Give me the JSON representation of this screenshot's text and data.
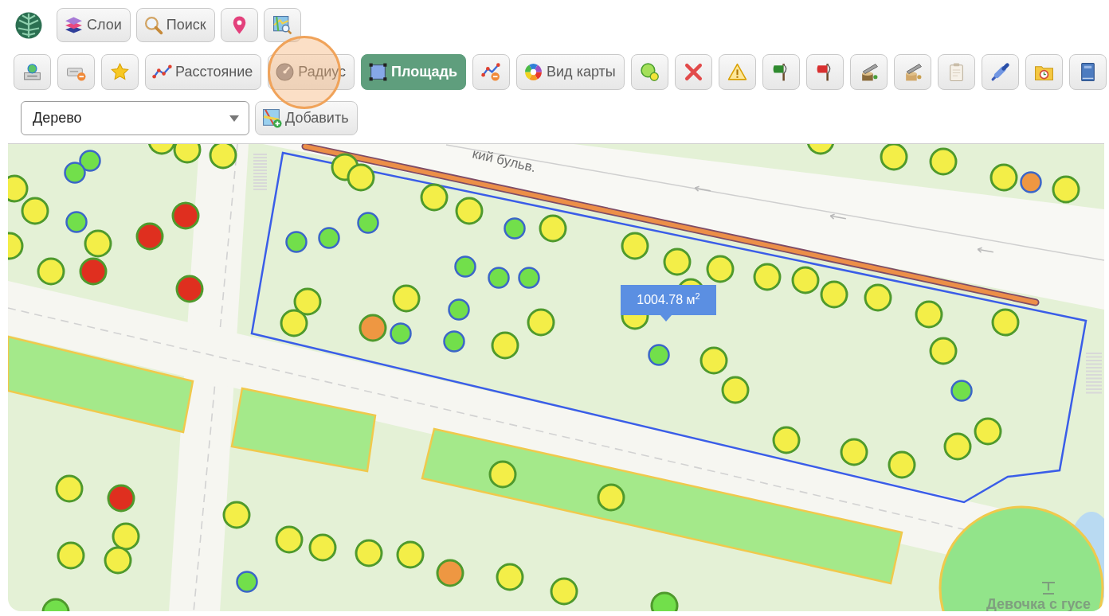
{
  "toolbar_top": [
    {
      "kind": "labeled",
      "label": "Слои"
    },
    {
      "kind": "labeled",
      "label": "Поиск"
    },
    {
      "kind": "icon"
    },
    {
      "kind": "icon"
    }
  ],
  "toolbar_tools": [
    {
      "kind": "icon",
      "selected": false,
      "highlighted": false
    },
    {
      "kind": "icon",
      "selected": false,
      "highlighted": false
    },
    {
      "kind": "icon",
      "selected": false,
      "highlighted": false
    },
    {
      "kind": "labeled",
      "label": "Расстояние",
      "selected": false,
      "highlighted": false
    },
    {
      "kind": "labeled",
      "label": "Радиус",
      "selected": false,
      "highlighted": true
    },
    {
      "kind": "labeled",
      "label": "Площадь",
      "selected": true,
      "highlighted": false
    },
    {
      "kind": "icon",
      "selected": false,
      "highlighted": false
    },
    {
      "kind": "labeled",
      "label": "Вид карты",
      "selected": false,
      "highlighted": false
    },
    {
      "kind": "icon",
      "selected": false,
      "highlighted": false
    },
    {
      "kind": "icon",
      "selected": false,
      "highlighted": false
    },
    {
      "kind": "icon",
      "selected": false,
      "highlighted": false
    },
    {
      "kind": "icon",
      "selected": false,
      "highlighted": false
    },
    {
      "kind": "icon",
      "selected": false,
      "highlighted": false
    },
    {
      "kind": "icon",
      "selected": false,
      "highlighted": false
    },
    {
      "kind": "icon",
      "selected": false,
      "highlighted": false
    },
    {
      "kind": "icon",
      "selected": false,
      "highlighted": false
    },
    {
      "kind": "icon",
      "selected": false,
      "highlighted": false
    },
    {
      "kind": "icon",
      "selected": false,
      "highlighted": false
    },
    {
      "kind": "icon",
      "selected": false,
      "highlighted": false
    }
  ],
  "feature_select": {
    "value": "Дерево"
  },
  "add_button": {
    "label": "Добавить"
  },
  "map": {
    "street_label": "кий бульв.",
    "trees": [
      {
        "kind": "large",
        "color": "#f3ee48"
      },
      {
        "kind": "large",
        "color": "#f3ee48"
      },
      {
        "kind": "large",
        "color": "#f3ee48"
      },
      {
        "kind": "large",
        "color": "#f3ee48"
      },
      {
        "kind": "large",
        "color": "#f3ee48"
      },
      {
        "kind": "small",
        "color": "#72df4b"
      },
      {
        "kind": "large",
        "color": "#f3ee48"
      },
      {
        "kind": "large",
        "color": "#f3ee48"
      },
      {
        "kind": "small",
        "color": "#72df4b"
      },
      {
        "kind": "large",
        "color": "#f3ee48"
      },
      {
        "kind": "large",
        "color": "#f3ee48"
      },
      {
        "kind": "small",
        "color": "#ee9742"
      },
      {
        "kind": "large",
        "color": "#f3ee48"
      },
      {
        "kind": "large",
        "color": "#f3ee48"
      },
      {
        "kind": "large",
        "color": "#f3ee48"
      },
      {
        "kind": "large",
        "color": "#f3ee48"
      },
      {
        "kind": "large",
        "color": "#f3ee48"
      },
      {
        "kind": "large",
        "color": "#df2f1f"
      },
      {
        "kind": "small",
        "color": "#72df4b"
      },
      {
        "kind": "small",
        "color": "#72df4b"
      },
      {
        "kind": "small",
        "color": "#72df4b"
      },
      {
        "kind": "large",
        "color": "#f3ee48"
      },
      {
        "kind": "large",
        "color": "#df2f1f"
      },
      {
        "kind": "small",
        "color": "#72df4b"
      },
      {
        "kind": "small",
        "color": "#72df4b"
      },
      {
        "kind": "large",
        "color": "#f3ee48"
      },
      {
        "kind": "large",
        "color": "#f3ee48"
      },
      {
        "kind": "large",
        "color": "#f3ee48"
      },
      {
        "kind": "large",
        "color": "#f3ee48"
      },
      {
        "kind": "small",
        "color": "#72df4b"
      },
      {
        "kind": "large",
        "color": "#f3ee48"
      },
      {
        "kind": "large",
        "color": "#f3ee48"
      },
      {
        "kind": "large",
        "color": "#df2f1f"
      },
      {
        "kind": "large",
        "color": "#f3ee48"
      },
      {
        "kind": "small",
        "color": "#72df4b"
      },
      {
        "kind": "small",
        "color": "#72df4b"
      },
      {
        "kind": "large",
        "color": "#f3ee48"
      },
      {
        "kind": "large",
        "color": "#df2f1f"
      },
      {
        "kind": "large",
        "color": "#f3ee48"
      },
      {
        "kind": "large",
        "color": "#f3ee48"
      },
      {
        "kind": "large",
        "color": "#f3ee48"
      },
      {
        "kind": "large",
        "color": "#f3ee48"
      },
      {
        "kind": "large",
        "color": "#f3ee48"
      },
      {
        "kind": "small",
        "color": "#72df4b"
      },
      {
        "kind": "large",
        "color": "#f3ee48"
      },
      {
        "kind": "large",
        "color": "#f3ee48"
      },
      {
        "kind": "large",
        "color": "#f3ee48"
      },
      {
        "kind": "large",
        "color": "#f3ee48"
      },
      {
        "kind": "large",
        "color": "#f3ee48"
      },
      {
        "kind": "large",
        "color": "#ee9742"
      },
      {
        "kind": "small",
        "color": "#72df4b"
      },
      {
        "kind": "small",
        "color": "#72df4b"
      },
      {
        "kind": "large",
        "color": "#f3ee48"
      },
      {
        "kind": "large",
        "color": "#f3ee48"
      },
      {
        "kind": "small",
        "color": "#72df4b"
      },
      {
        "kind": "large",
        "color": "#f3ee48"
      },
      {
        "kind": "large",
        "color": "#f3ee48"
      },
      {
        "kind": "small",
        "color": "#72df4b"
      },
      {
        "kind": "large",
        "color": "#f3ee48"
      },
      {
        "kind": "large",
        "color": "#f3ee48"
      },
      {
        "kind": "large",
        "color": "#f3ee48"
      },
      {
        "kind": "large",
        "color": "#f3ee48"
      },
      {
        "kind": "large",
        "color": "#f3ee48"
      },
      {
        "kind": "large",
        "color": "#f3ee48"
      },
      {
        "kind": "large",
        "color": "#f3ee48"
      },
      {
        "kind": "large",
        "color": "#f3ee48"
      },
      {
        "kind": "large",
        "color": "#df2f1f"
      },
      {
        "kind": "large",
        "color": "#f3ee48"
      },
      {
        "kind": "large",
        "color": "#f3ee48"
      },
      {
        "kind": "large",
        "color": "#f3ee48"
      },
      {
        "kind": "large",
        "color": "#f3ee48"
      },
      {
        "kind": "large",
        "color": "#f3ee48"
      },
      {
        "kind": "large",
        "color": "#f3ee48"
      },
      {
        "kind": "large",
        "color": "#f3ee48"
      },
      {
        "kind": "large",
        "color": "#f3ee48"
      },
      {
        "kind": "large",
        "color": "#ee9742"
      },
      {
        "kind": "large",
        "color": "#f3ee48"
      },
      {
        "kind": "small",
        "color": "#72df4b"
      },
      {
        "kind": "large",
        "color": "#f3ee48"
      },
      {
        "kind": "large",
        "color": "#72df4b"
      },
      {
        "kind": "large",
        "color": "#72df4b"
      }
    ],
    "area_label": "1004.78 м$^{2}$",
    "place_label": "Девочка с гусе"
  }
}
